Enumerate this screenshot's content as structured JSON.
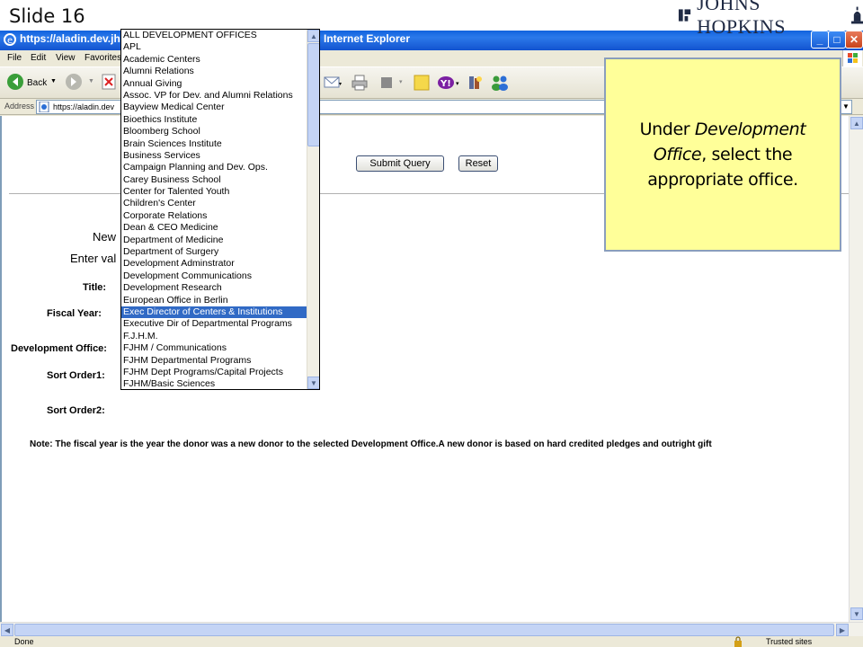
{
  "slide": {
    "title": "Slide 16",
    "logo_text": "JOHNS HOPKINS"
  },
  "browser": {
    "title_url": "https://aladin.dev.jhu",
    "title_app": "Internet Explorer",
    "menu": [
      "File",
      "Edit",
      "View",
      "Favorites"
    ],
    "back_label": "Back",
    "address_label": "Address",
    "address_value": "https://aladin.dev",
    "status_text": "Done",
    "zone_text": "Trusted sites"
  },
  "form": {
    "submit_label": "Submit Query",
    "reset_label": "Reset",
    "heading_new": "New",
    "heading_enter": "Enter val",
    "labels": {
      "title": "Title:",
      "fiscal_year": "Fiscal Year:",
      "development_office": "Development Office:",
      "sort_order1": "Sort Order1:",
      "sort_order2": "Sort Order2:"
    },
    "note": "Note: The fiscal year is the year the donor was a new donor to the selected Development Office.A new donor is based on hard credited pledges and outright gift"
  },
  "dropdown": {
    "selected_index": 23,
    "options": [
      "ALL DEVELOPMENT OFFICES",
      "APL",
      "Academic Centers",
      "Alumni Relations",
      "Annual Giving",
      "Assoc. VP for Dev. and Alumni Relations",
      "Bayview Medical Center",
      "Bioethics Institute",
      "Bloomberg School",
      "Brain Sciences Institute",
      "Business Services",
      "Campaign Planning and Dev. Ops.",
      "Carey Business School",
      "Center for Talented Youth",
      "Children's Center",
      "Corporate Relations",
      "Dean & CEO Medicine",
      "Department of Medicine",
      "Department of Surgery",
      "Development Adminstrator",
      "Development Communications",
      "Development Research",
      "European Office in Berlin",
      "Exec Director of Centers & Institutions",
      "Executive Dir of Departmental Programs",
      "F.J.H.M.",
      "FJHM / Communications",
      "FJHM Departmental Programs",
      "FJHM Dept Programs/Capital Projects",
      "FJHM/Basic Sciences"
    ]
  },
  "callout": {
    "prefix": "Under ",
    "emphasis": "Development Office",
    "suffix": ", select the appropriate office."
  },
  "colors": {
    "selection": "#316ac5",
    "callout_bg": "#ffff99",
    "titlebar": "#0a5ddb"
  }
}
